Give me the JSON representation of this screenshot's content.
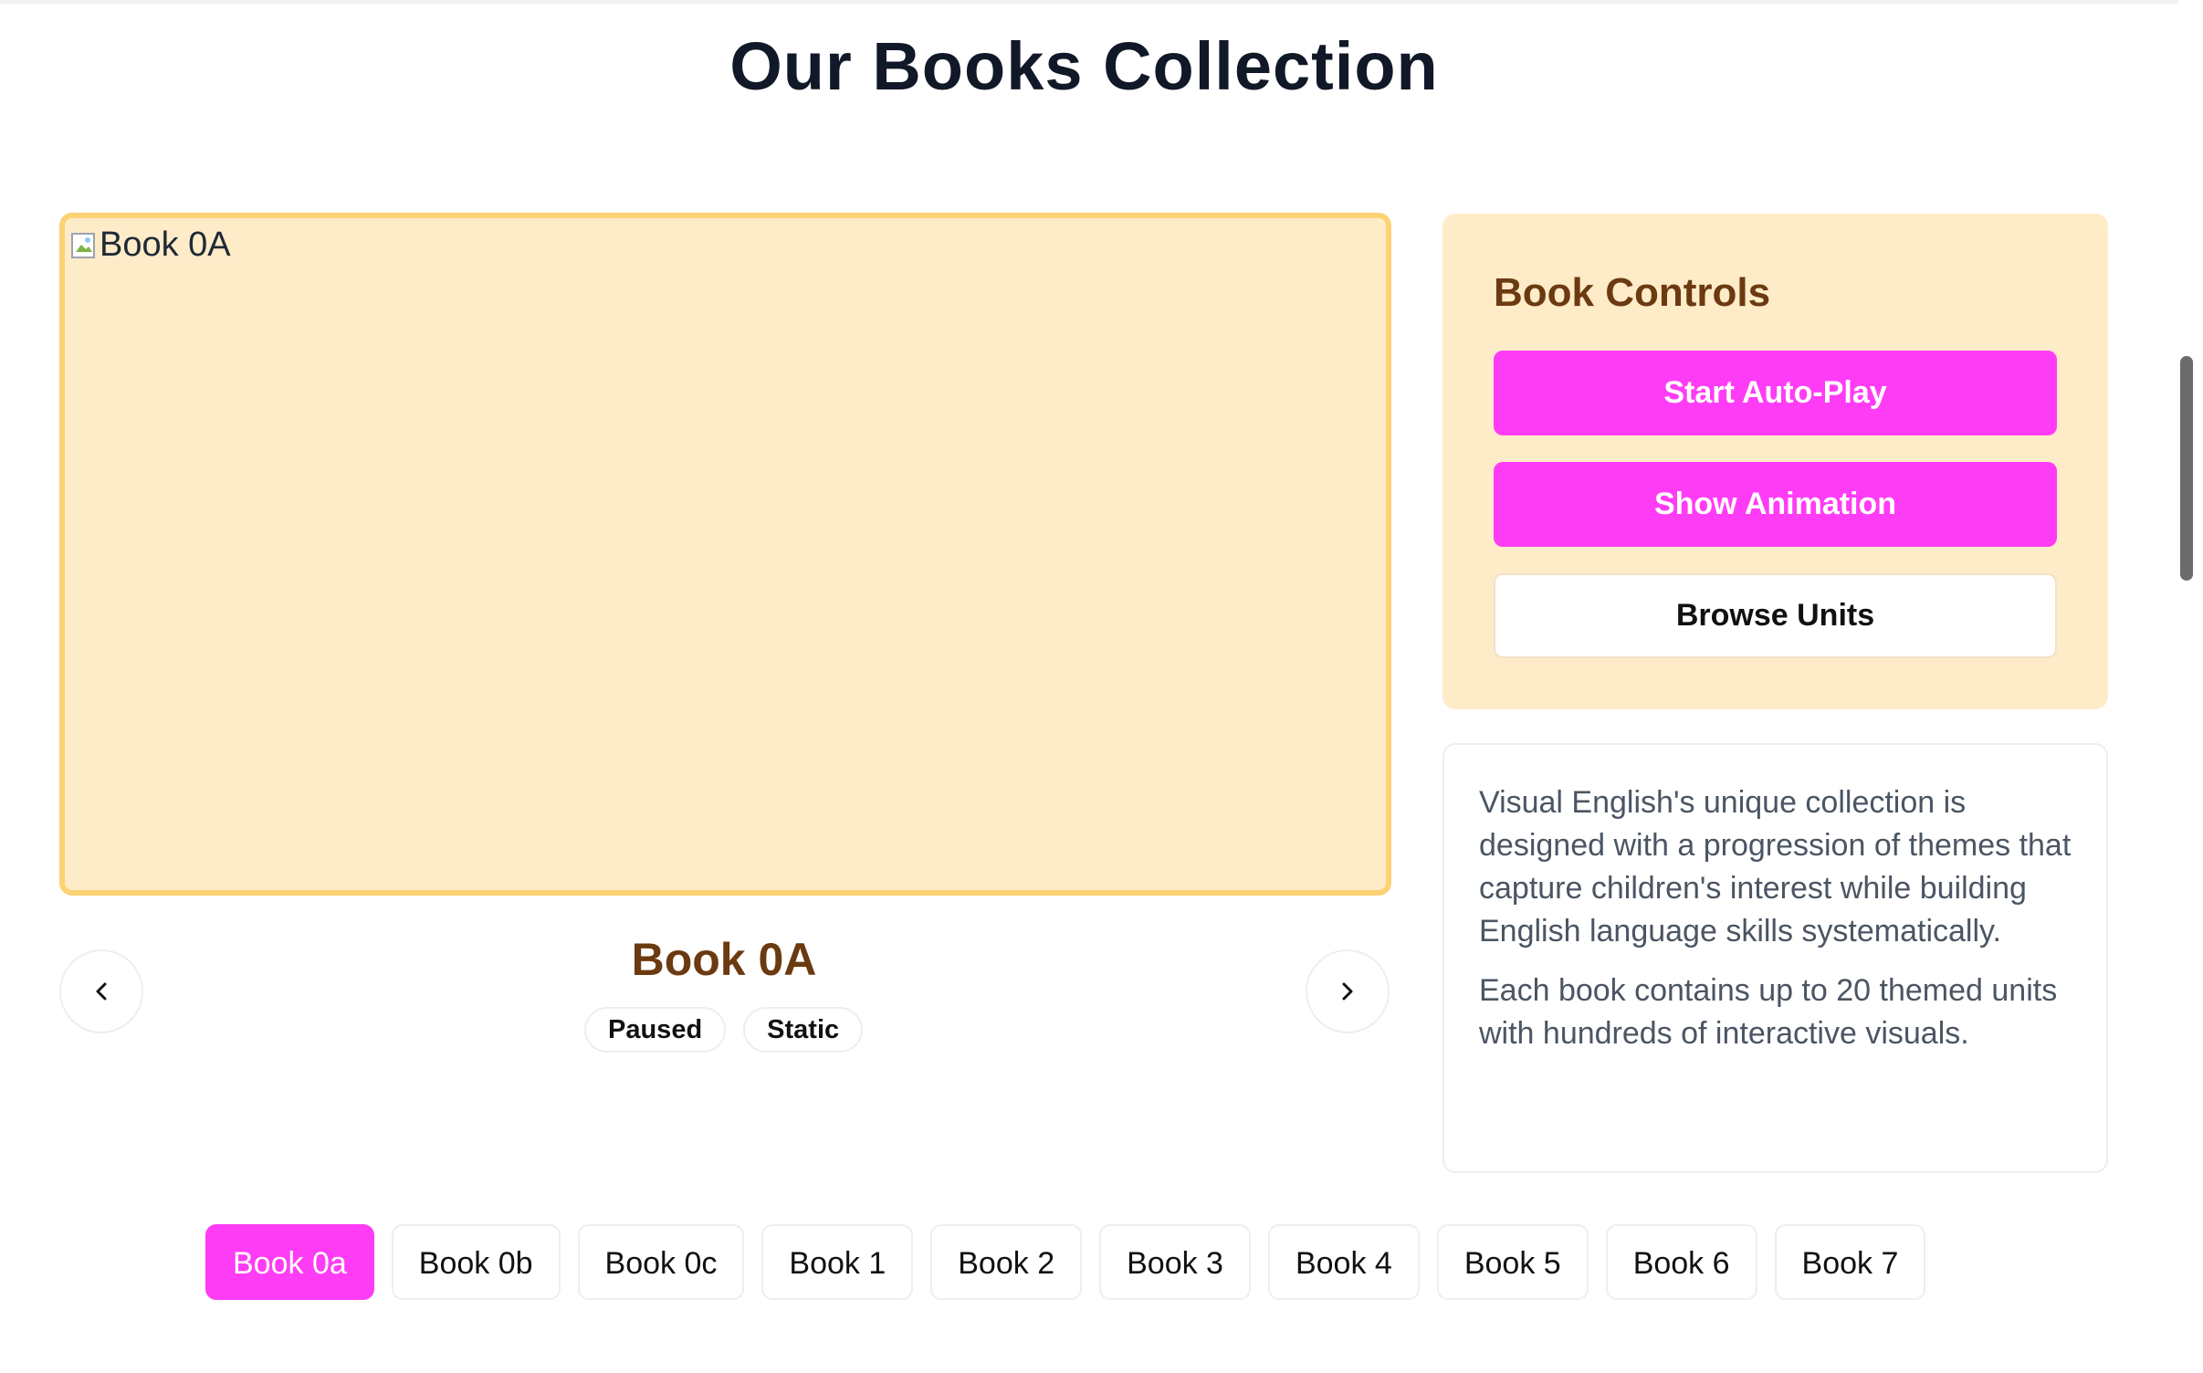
{
  "page": {
    "title": "Our Books Collection"
  },
  "book_display": {
    "image_alt": "Book 0A",
    "caption": "Book 0A",
    "badges": [
      "Paused",
      "Static"
    ]
  },
  "controls": {
    "title": "Book Controls",
    "buttons": [
      "Start Auto-Play",
      "Show Animation",
      "Browse Units"
    ]
  },
  "info": {
    "paragraphs": [
      "Visual English's unique collection is designed with a progression of themes that capture children's interest while building English language skills systematically.",
      "Each book contains up to 20 themed units with hundreds of interactive visuals."
    ]
  },
  "tabs": {
    "items": [
      "Book 0a",
      "Book 0b",
      "Book 0c",
      "Book 1",
      "Book 2",
      "Book 3",
      "Book 4",
      "Book 5",
      "Book 6",
      "Book 7"
    ],
    "active": "Book 0a"
  },
  "colors": {
    "accent": "#ff3cf5",
    "panel_bg": "#feebc8",
    "frame_border": "#fcd273",
    "heading_brown": "#6b3a10"
  },
  "icons": {
    "prev": "chevron-left-icon",
    "next": "chevron-right-icon",
    "broken_image": "broken-image-icon"
  }
}
